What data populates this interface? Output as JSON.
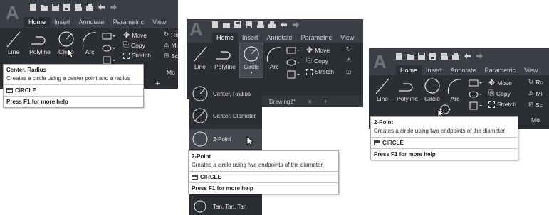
{
  "app": {
    "logo_letter": "A"
  },
  "tabs": [
    "Home",
    "Insert",
    "Annotate",
    "Parametric",
    "View"
  ],
  "draw_tools": {
    "line": "Line",
    "polyline": "Polyline",
    "circle": "Circle",
    "arc": "Arc"
  },
  "modify": {
    "move": "Move",
    "copy": "Copy",
    "stretch": "Stretch",
    "rotate_partial": "Ro",
    "mirror_partial": "Mi",
    "scale_partial": "Sc",
    "more_partial": "Mo"
  },
  "panel1": {
    "tip_title": "Center, Radius",
    "tip_desc": "Creates a circle using a center point and a radius",
    "tip_command": "CIRCLE",
    "tip_help": "Press F1 for more help",
    "docbar_plus": "+"
  },
  "panel2": {
    "dropdown": [
      "Center, Radius",
      "Center, Diameter",
      "2-Point",
      "Tan, Tan, Tan"
    ],
    "doc_tab": "Drawing2*",
    "doc_close": "×",
    "doc_plus": "+",
    "tip_title": "2-Point",
    "tip_desc": "Creates a circle using two endpoints of the diameter",
    "tip_command": "CIRCLE",
    "tip_help": "Press F1 for more help"
  },
  "panel3": {
    "tip_title": "2-Point",
    "tip_desc": "Creates a circle using two endpoints of the diameter",
    "tip_command": "CIRCLE",
    "tip_help": "Press F1 for more help"
  },
  "colors": {
    "ribbon_dark": "#2b2e33",
    "title_dark": "#3b3f45",
    "text_light": "#e6e6e6"
  }
}
